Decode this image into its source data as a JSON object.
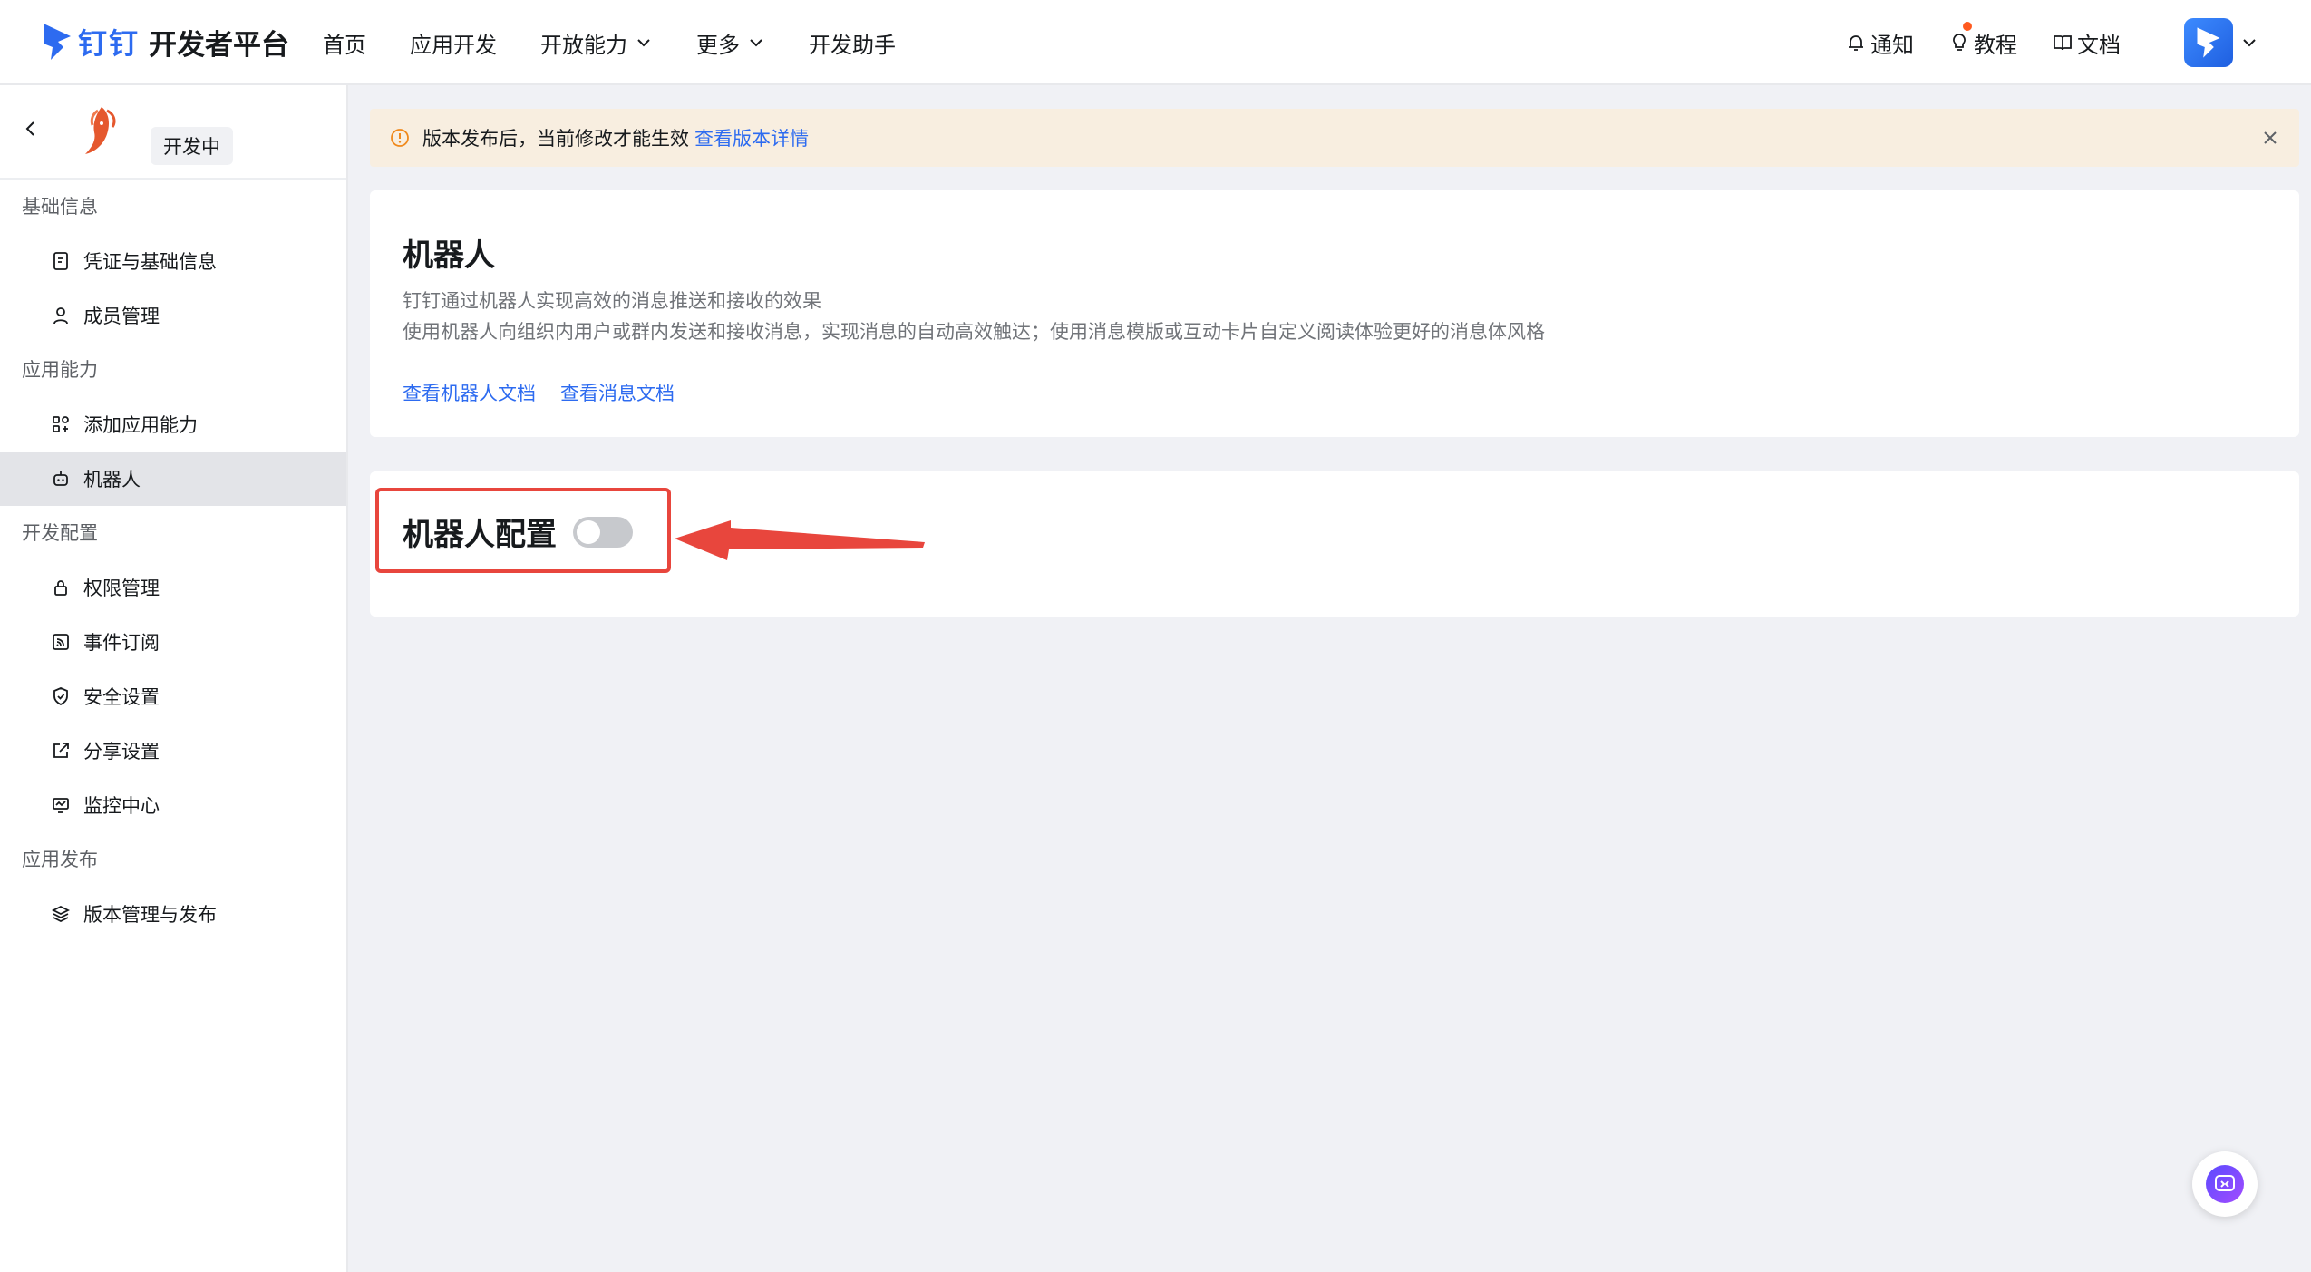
{
  "header": {
    "brand": "钉钉",
    "platform_title": "开发者平台",
    "nav": [
      {
        "label": "首页"
      },
      {
        "label": "应用开发"
      },
      {
        "label": "开放能力"
      },
      {
        "label": "更多"
      },
      {
        "label": "开发助手"
      }
    ],
    "right": {
      "notify": "通知",
      "tutorial": "教程",
      "docs": "文档"
    }
  },
  "sidebar": {
    "status": "开发中",
    "groups": [
      {
        "title": "基础信息",
        "items": [
          {
            "label": "凭证与基础信息"
          },
          {
            "label": "成员管理"
          }
        ]
      },
      {
        "title": "应用能力",
        "items": [
          {
            "label": "添加应用能力"
          },
          {
            "label": "机器人"
          }
        ]
      },
      {
        "title": "开发配置",
        "items": [
          {
            "label": "权限管理"
          },
          {
            "label": "事件订阅"
          },
          {
            "label": "安全设置"
          },
          {
            "label": "分享设置"
          },
          {
            "label": "监控中心"
          }
        ]
      },
      {
        "title": "应用发布",
        "items": [
          {
            "label": "版本管理与发布"
          }
        ]
      }
    ]
  },
  "banner": {
    "text": "版本发布后，当前修改才能生效",
    "link": "查看版本详情"
  },
  "robot_card": {
    "title": "机器人",
    "desc1": "钉钉通过机器人实现高效的消息推送和接收的效果",
    "desc2": "使用机器人向组织内用户或群内发送和接收消息，实现消息的自动高效触达；使用消息模版或互动卡片自定义阅读体验更好的消息体风格",
    "link_robot_doc": "查看机器人文档",
    "link_msg_doc": "查看消息文档"
  },
  "config_card": {
    "title": "机器人配置",
    "toggle_on": false
  },
  "colors": {
    "accent": "#2d6bf0",
    "highlight": "#e8463d",
    "banner_bg": "#f8eee0"
  }
}
